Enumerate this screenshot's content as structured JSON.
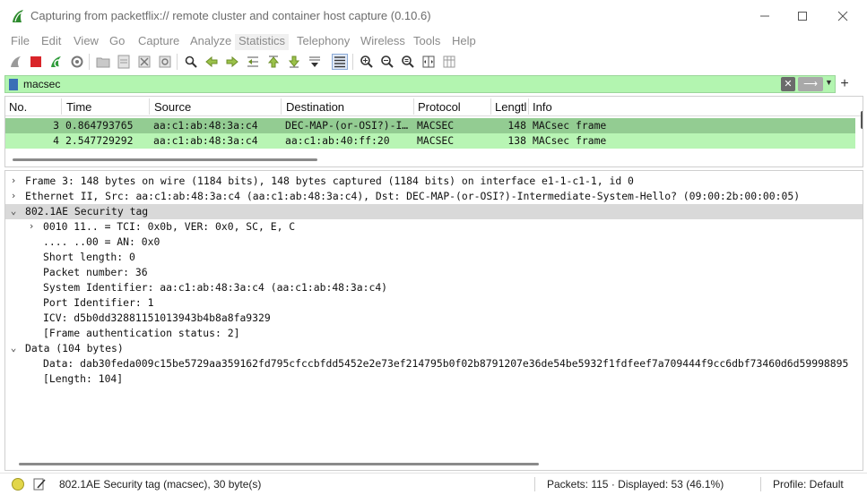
{
  "window": {
    "title": "Capturing from packetflix:// remote cluster and container host capture (0.10.6)"
  },
  "menu": [
    "File",
    "Edit",
    "View",
    "Go",
    "Capture",
    "Analyze",
    "Statistics",
    "Telephony",
    "Wireless",
    "Tools",
    "Help"
  ],
  "filter": {
    "value": "macsec"
  },
  "packet_list": {
    "columns": [
      "No.",
      "Time",
      "Source",
      "Destination",
      "Protocol",
      "Lengtl",
      "Info"
    ],
    "rows": [
      {
        "no": "3",
        "time": "0.864793765",
        "source": "aa:c1:ab:48:3a:c4",
        "destination": "DEC-MAP-(or-OSI?)-I…",
        "protocol": "MACSEC",
        "length": "148",
        "info": "MACsec frame"
      },
      {
        "no": "4",
        "time": "2.547729292",
        "source": "aa:c1:ab:48:3a:c4",
        "destination": "aa:c1:ab:40:ff:20",
        "protocol": "MACSEC",
        "length": "138",
        "info": "MACsec frame"
      }
    ]
  },
  "details": [
    {
      "indent": 0,
      "expand": "›",
      "text": "Frame 3: 148 bytes on wire (1184 bits), 148 bytes captured (1184 bits) on interface e1-1-c1-1, id 0",
      "highlight": false
    },
    {
      "indent": 0,
      "expand": "›",
      "text": "Ethernet II, Src: aa:c1:ab:48:3a:c4 (aa:c1:ab:48:3a:c4), Dst: DEC-MAP-(or-OSI?)-Intermediate-System-Hello? (09:00:2b:00:00:05)",
      "highlight": false
    },
    {
      "indent": 0,
      "expand": "⌄",
      "text": "802.1AE Security tag",
      "highlight": true
    },
    {
      "indent": 1,
      "expand": "›",
      "text": "0010 11.. = TCI: 0x0b, VER: 0x0, SC, E, C",
      "highlight": false
    },
    {
      "indent": 2,
      "expand": "",
      "text": ".... ..00 = AN: 0x0",
      "highlight": false
    },
    {
      "indent": 2,
      "expand": "",
      "text": "Short length: 0",
      "highlight": false
    },
    {
      "indent": 2,
      "expand": "",
      "text": "Packet number: 36",
      "highlight": false
    },
    {
      "indent": 2,
      "expand": "",
      "text": "System Identifier: aa:c1:ab:48:3a:c4 (aa:c1:ab:48:3a:c4)",
      "highlight": false
    },
    {
      "indent": 2,
      "expand": "",
      "text": "Port Identifier: 1",
      "highlight": false
    },
    {
      "indent": 2,
      "expand": "",
      "text": "ICV: d5b0dd32881151013943b4b8a8fa9329",
      "highlight": false
    },
    {
      "indent": 2,
      "expand": "",
      "text": "[Frame authentication status: 2]",
      "highlight": false
    },
    {
      "indent": 0,
      "expand": "⌄",
      "text": "Data (104 bytes)",
      "highlight": false
    },
    {
      "indent": 2,
      "expand": "",
      "text": "Data: dab30feda009c15be5729aa359162fd795cfccbfdd5452e2e73ef214795b0f02b8791207e36de54be5932f1fdfeef7a709444f9cc6dbf73460d6d59998895",
      "highlight": false
    },
    {
      "indent": 2,
      "expand": "",
      "text": "[Length: 104]",
      "highlight": false
    }
  ],
  "status": {
    "field": "802.1AE Security tag (macsec), 30 byte(s)",
    "packets": "Packets: 115 · Displayed: 53 (46.1%)",
    "profile": "Profile: Default"
  },
  "colors": {
    "filter_bg": "#b3f5b0",
    "selected_row": "#93cc92",
    "macsec_row": "#b8f5b4",
    "detail_highlight": "#d9d9d9"
  }
}
